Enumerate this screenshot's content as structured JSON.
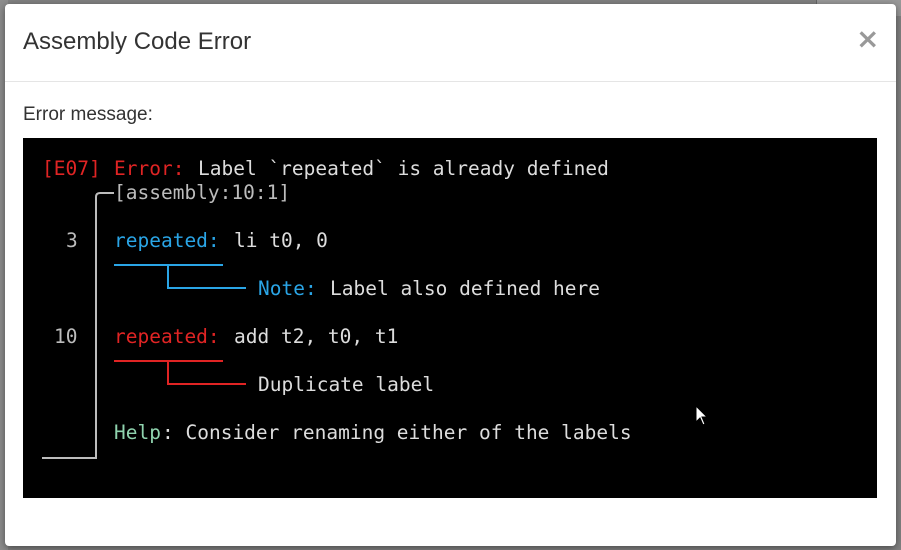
{
  "dialog": {
    "title": "Assembly Code Error",
    "close_symbol": "×",
    "message_label": "Error message:"
  },
  "terminal": {
    "code": "[E07]",
    "error_label": "Error:",
    "error_text": "Label `repeated` is already defined",
    "location": "[assembly:10:1]",
    "line1_num": "3",
    "line1_label": "repeated:",
    "line1_rest": "li t0, 0",
    "note_label": "Note:",
    "note_text": "Label also defined here",
    "line2_num": "10",
    "line2_label": "repeated:",
    "line2_rest": "add t2, t0, t1",
    "dup_text": "Duplicate label",
    "help_label": "Help",
    "help_text": ": Consider renaming either of the labels"
  },
  "colors": {
    "error_red": "#e02424",
    "note_blue": "#2aa5e6",
    "help_green": "#8fd3ae",
    "terminal_bg": "#000000"
  }
}
